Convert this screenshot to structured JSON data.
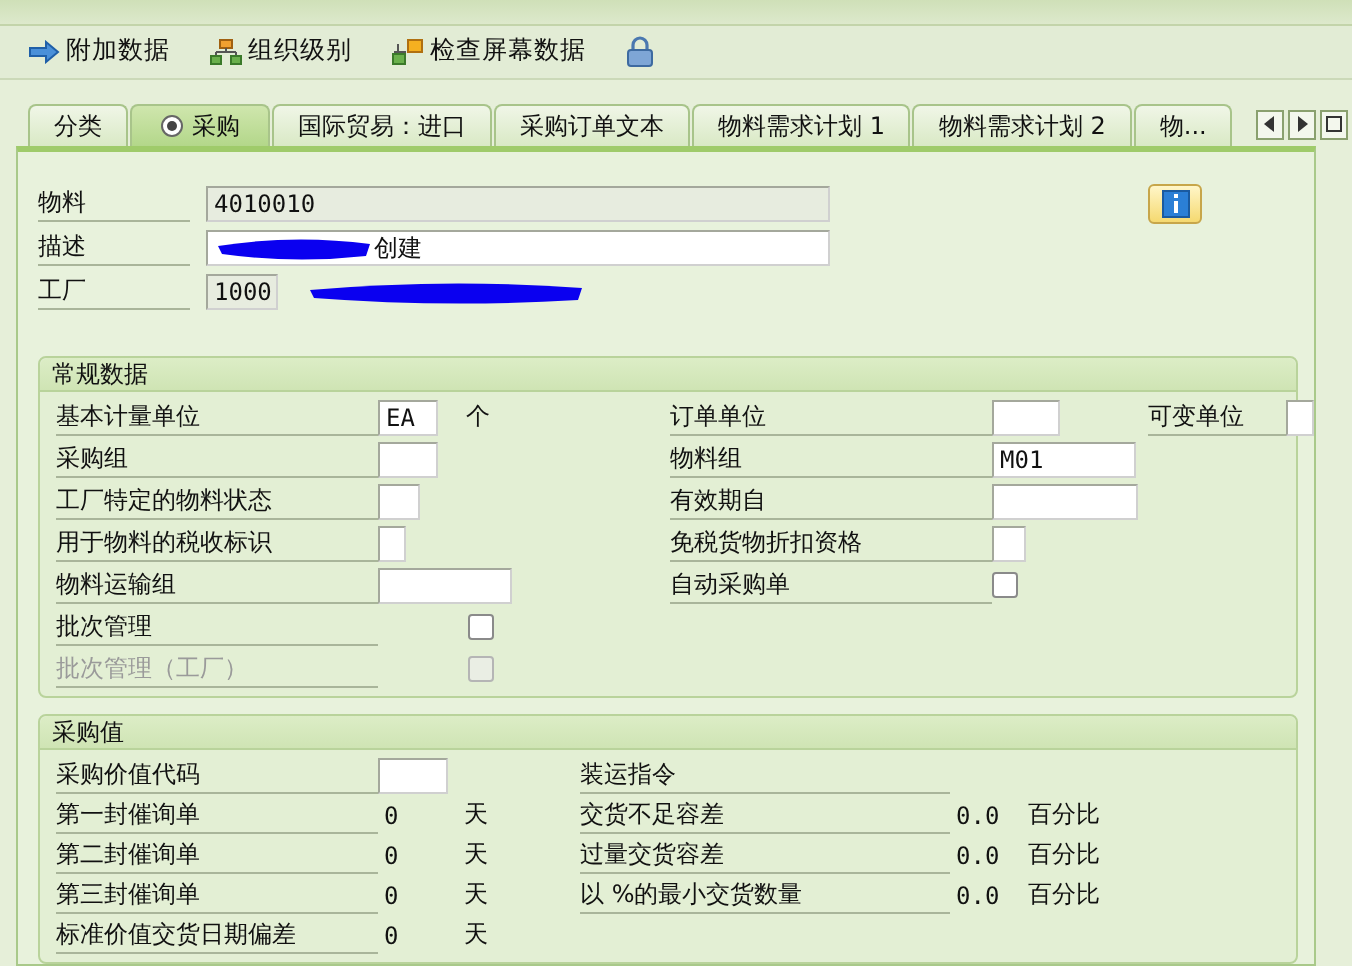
{
  "toolbar": [
    {
      "label": "附加数据",
      "kind": "arrow"
    },
    {
      "label": "组织级别",
      "kind": "hierarchy"
    },
    {
      "label": "检查屏幕数据",
      "kind": "check"
    },
    {
      "kind": "lock"
    }
  ],
  "tabs": [
    {
      "label": "分类",
      "selected": false
    },
    {
      "label": "采购",
      "selected": true
    },
    {
      "label": "国际贸易：进口",
      "selected": false
    },
    {
      "label": "采购订单文本",
      "selected": false
    },
    {
      "label": "物料需求计划 1",
      "selected": false
    },
    {
      "label": "物料需求计划 2",
      "selected": false
    },
    {
      "label": "物...",
      "selected": false
    }
  ],
  "header_fields": [
    {
      "label": "物料",
      "value": "4010010",
      "editable": false,
      "redacted": false
    },
    {
      "label": "描述",
      "value": "创建",
      "editable": true,
      "redacted": true
    },
    {
      "label": "工厂",
      "value": "1000",
      "editable": false,
      "redacted": true
    }
  ],
  "general_data": {
    "title": "常规数据",
    "rows": [
      [
        {
          "label": "基本计量单位",
          "kind": "input",
          "value": "EA",
          "unit": "个"
        },
        {
          "label": "订单单位",
          "kind": "input"
        },
        {
          "label": "可变单位",
          "kind": "input"
        }
      ],
      [
        {
          "label": "采购组",
          "kind": "input"
        },
        {
          "label": "物料组",
          "kind": "input",
          "value": "M01"
        }
      ],
      [
        {
          "label": "工厂特定的物料状态",
          "kind": "input"
        },
        {
          "label": "有效期自",
          "kind": "input"
        }
      ],
      [
        {
          "label": "用于物料的税收标识",
          "kind": "input"
        },
        {
          "label": "免税货物折扣资格",
          "kind": "input"
        }
      ],
      [
        {
          "label": "物料运输组",
          "kind": "input"
        },
        {
          "label": "自动采购单",
          "kind": "checkbox",
          "checked": false,
          "disabled": false
        }
      ],
      [
        {
          "label": "批次管理",
          "kind": "checkbox",
          "checked": false,
          "disabled": false
        }
      ],
      [
        {
          "label": "批次管理（工厂）",
          "kind": "checkbox",
          "checked": false,
          "disabled": true
        }
      ]
    ]
  },
  "purchasing_values": {
    "title": "采购值",
    "rows": [
      [
        {
          "label": "采购价值代码",
          "kind": "input"
        },
        {
          "label": "装运指令",
          "kind": "none"
        }
      ],
      [
        {
          "label": "第一封催询单",
          "kind": "display",
          "value": "0",
          "unit": "天"
        },
        {
          "label": "交货不足容差",
          "kind": "display",
          "value": "0.0",
          "unit": "百分比"
        }
      ],
      [
        {
          "label": "第二封催询单",
          "kind": "display",
          "value": "0",
          "unit": "天"
        },
        {
          "label": "过量交货容差",
          "kind": "display",
          "value": "0.0",
          "unit": "百分比"
        }
      ],
      [
        {
          "label": "第三封催询单",
          "kind": "display",
          "value": "0",
          "unit": "天"
        },
        {
          "label": "以 %的最小交货数量",
          "kind": "display",
          "value": "0.0",
          "unit": "百分比"
        }
      ],
      [
        {
          "label": "标准价值交货日期偏差",
          "kind": "display",
          "value": "0",
          "unit": "天"
        }
      ]
    ]
  }
}
